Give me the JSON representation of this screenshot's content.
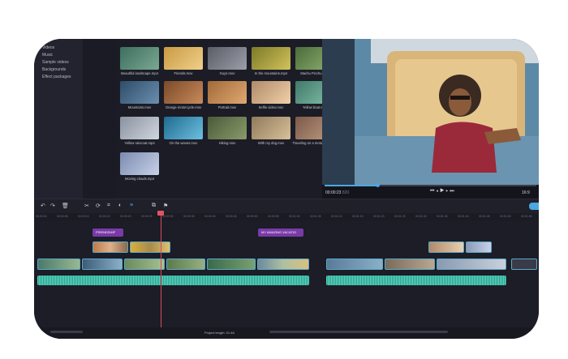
{
  "sidebar": {
    "items": [
      "Videos",
      "Music",
      "Sample videos",
      "Backgrounds",
      "Effect packages"
    ]
  },
  "media": {
    "tiles": [
      {
        "label": "Beautiful landscape.mp4",
        "color": "#4a7a6a"
      },
      {
        "label": "Friends.mov",
        "color": "#c9a054"
      },
      {
        "label": "Guys.mov",
        "color": "#6c6f7a"
      },
      {
        "label": "In the mountains.mp4",
        "color": "#8a8a3a"
      },
      {
        "label": "Machu Picchu.mov",
        "color": "#5b7b4a"
      },
      {
        "label": "Mountains.mov",
        "color": "#3e5c78"
      },
      {
        "label": "Orange motorcycle.mov",
        "color": "#8a5a3a"
      },
      {
        "label": "Portrait.mov",
        "color": "#b07a4a"
      },
      {
        "label": "Selfie video.mov",
        "color": "#c9a07a"
      },
      {
        "label": "Yellow boat.mov",
        "color": "#4f8a7a"
      },
      {
        "label": "Yellow raincoat.mp4",
        "color": "#9aa2b0"
      },
      {
        "label": "On the waves.mov",
        "color": "#2f7aa0"
      },
      {
        "label": "Hiking.mov",
        "color": "#5a6a4a"
      },
      {
        "label": "With my dog.mov",
        "color": "#a08a6a"
      },
      {
        "label": "Traveling on a motorbike.mp4",
        "color": "#8a6a5a"
      },
      {
        "label": "Moving clouds.mp4",
        "color": "#8a9ab8"
      }
    ]
  },
  "player": {
    "timecode": "00:00:23",
    "timecode_ms": "820",
    "progress": 0.25,
    "aspect": "16:9"
  },
  "timeline": {
    "ticks": [
      "00:00:00",
      "00:00:05",
      "00:00:10",
      "00:00:15",
      "00:00:20",
      "00:00:25",
      "00:00:30",
      "00:00:35",
      "00:00:40",
      "00:00:45",
      "00:00:50",
      "00:00:55",
      "00:01:00",
      "00:01:05",
      "00:01:10",
      "00:01:15",
      "00:01:20",
      "00:01:25",
      "00:01:30",
      "00:01:35",
      "00:01:40",
      "00:01:45",
      "00:01:50",
      "00:01:55"
    ],
    "titles": [
      "FRIENDSHIP",
      "MY AMAZING VACATIO"
    ]
  },
  "status": {
    "project_length": "Project length: 01:48"
  },
  "colors": {
    "accent": "#7a3aa8",
    "clip_border": "#59a8c7",
    "audio": "#59d8c0",
    "playhead": "#d44c5d"
  }
}
